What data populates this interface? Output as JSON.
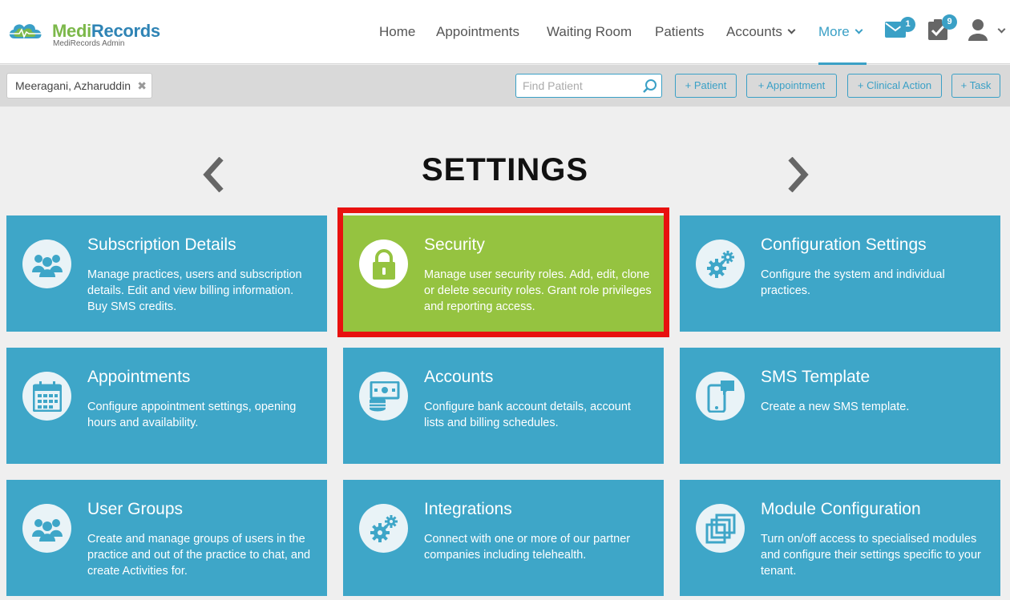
{
  "brand": {
    "name_part1": "Medi",
    "name_part2": "Records",
    "subtitle": "MediRecords Admin"
  },
  "nav": {
    "items": [
      {
        "label": "Home"
      },
      {
        "label": "Appointments"
      },
      {
        "label": "Waiting Room"
      },
      {
        "label": "Patients"
      },
      {
        "label": "Accounts"
      },
      {
        "label": "More"
      }
    ],
    "messages_badge": "1",
    "tasks_badge": "9"
  },
  "subbar": {
    "patient_name": "Meeragani, Azharuddin",
    "chip_close": "✖",
    "search_placeholder": "Find Patient",
    "buttons": [
      {
        "label": "+ Patient"
      },
      {
        "label": "+ Appointment"
      },
      {
        "label": "+ Clinical Action"
      },
      {
        "label": "+ Task"
      }
    ]
  },
  "page": {
    "title": "SETTINGS"
  },
  "tiles": [
    {
      "title": "Subscription Details",
      "desc": "Manage practices, users and subscription details. Edit and view billing information. Buy SMS credits.",
      "icon": "users-icon"
    },
    {
      "title": "Security",
      "desc": "Manage user security roles. Add, edit, clone or delete security roles. Grant role privileges and reporting access.",
      "icon": "lock-icon"
    },
    {
      "title": "Configuration Settings",
      "desc": "Configure the system and individual practices.",
      "icon": "gears-icon"
    },
    {
      "title": "Appointments",
      "desc": "Configure appointment settings, opening hours and availability.",
      "icon": "calendar-icon"
    },
    {
      "title": "Accounts",
      "desc": "Configure bank account details, account lists and billing schedules.",
      "icon": "money-icon"
    },
    {
      "title": "SMS Template",
      "desc": "Create a new SMS template.",
      "icon": "phone-message-icon"
    },
    {
      "title": "User Groups",
      "desc": "Create and manage groups of users in the practice and out of the practice to chat, and create Activities for.",
      "icon": "users-icon"
    },
    {
      "title": "Integrations",
      "desc": "Connect with one or more of our partner companies including telehealth.",
      "icon": "gears-icon"
    },
    {
      "title": "Module Configuration",
      "desc": "Turn on/off access to specialised modules and configure their settings specific to your tenant.",
      "icon": "modules-icon"
    }
  ],
  "colors": {
    "tile_blue": "#3ea6c8",
    "tile_green": "#95c340",
    "accent": "#3aa0c6",
    "highlight_red": "#e8110f"
  }
}
